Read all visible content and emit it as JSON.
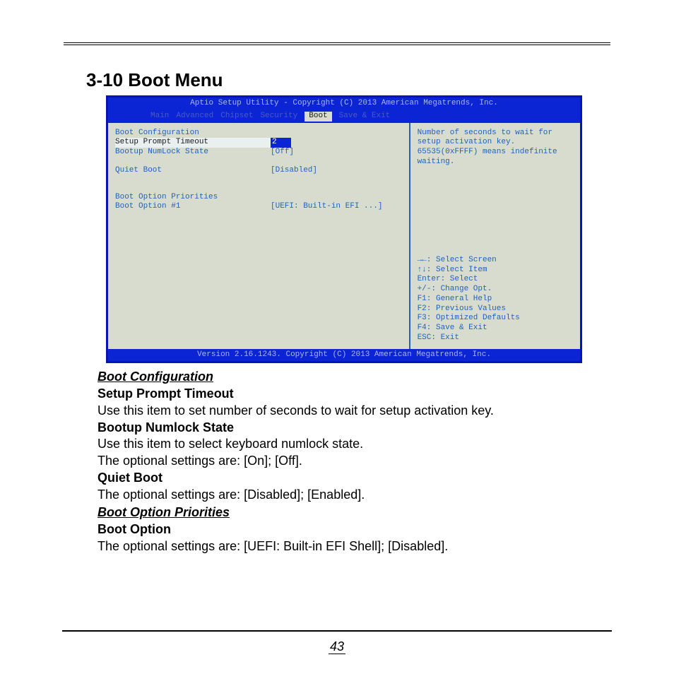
{
  "section_title": "3-10 Boot Menu",
  "bios": {
    "header": "Aptio Setup Utility - Copyright (C) 2013 American Megatrends, Inc.",
    "tabs": [
      "Main",
      "Advanced",
      "Chipset",
      "Security",
      "Boot",
      "Save & Exit"
    ],
    "active_tab": "Boot",
    "left": {
      "section1": "Boot Configuration",
      "row_prompt_label": "Setup Prompt Timeout",
      "row_prompt_value": "2",
      "row_numlock_label": "Bootup NumLock State",
      "row_numlock_value": "[Off]",
      "row_quiet_label": "Quiet Boot",
      "row_quiet_value": "[Disabled]",
      "section2": "Boot Option Priorities",
      "row_bootopt_label": "Boot Option #1",
      "row_bootopt_value": "[UEFI: Built-in EFI ...]"
    },
    "right": {
      "desc_l1": "Number of seconds to wait for",
      "desc_l2": "setup activation key.",
      "desc_l3": "65535(0xFFFF) means indefinite",
      "desc_l4": "waiting.",
      "key_l1": "→←: Select Screen",
      "key_l2": "↑↓: Select Item",
      "key_l3": "Enter: Select",
      "key_l4": "+/-: Change Opt.",
      "key_l5": "F1: General Help",
      "key_l6": "F2: Previous Values",
      "key_l7": "F3: Optimized Defaults",
      "key_l8": "F4: Save & Exit",
      "key_l9": "ESC: Exit"
    },
    "footer": "Version 2.16.1243. Copyright (C) 2013 American Megatrends, Inc."
  },
  "doc": {
    "sub1": "Boot Configuration",
    "h1": "Setup Prompt Timeout",
    "p1": "Use this item to set number of seconds to wait for setup activation key.",
    "h2": "Bootup Numlock State",
    "p2a": "Use this item to select keyboard numlock state.",
    "p2b": "The optional settings are: [On]; [Off].",
    "h3": "Quiet Boot",
    "p3": "The optional settings are: [Disabled]; [Enabled].",
    "sub2": "Boot Option Priorities",
    "h4": "Boot Option",
    "p4": "The optional settings are: [UEFI: Built-in EFI Shell]; [Disabled]."
  },
  "page_number": "43"
}
